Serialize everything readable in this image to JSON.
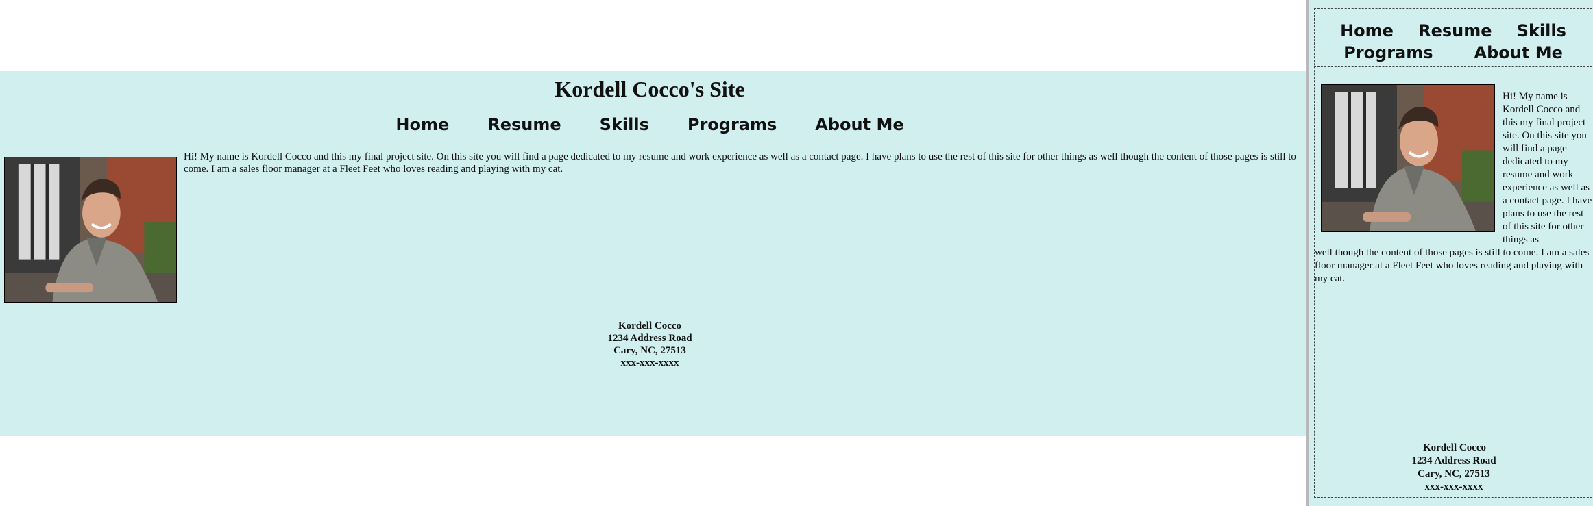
{
  "site": {
    "title": "Kordell Cocco's Site"
  },
  "nav": {
    "items": [
      {
        "label": "Home"
      },
      {
        "label": "Resume"
      },
      {
        "label": "Skills"
      },
      {
        "label": "Programs"
      },
      {
        "label": "About Me"
      }
    ]
  },
  "intro": {
    "text": "Hi! My name is Kordell Cocco and this my final project site. On this site you will find a page dedicated to my resume and work experience as well as a contact page. I have plans to use the rest of this site for other things as well though the content of those pages is still to come. I am a sales floor manager at a Fleet Feet who loves reading and playing with my cat.",
    "text_narrow_top": "Hi! My name is Kordell Cocco and this my final project site. On this site you will find a page dedicated to my resume and work experience as well as a contact page. I have plans to use the rest of this site for other things as",
    "text_narrow_bottom": "well though the content of those pages is still to come. I am a sales floor manager at a Fleet Feet who loves reading and playing with my cat."
  },
  "footer": {
    "name": "Kordell Cocco",
    "street": "1234 Address Road",
    "city": "Cary, NC, 27513",
    "phone": "xxx-xxx-xxxx"
  },
  "colors": {
    "background_band": "#d1efef",
    "page": "#ffffff",
    "text": "#111111"
  },
  "images": {
    "profile_photo": "photo of a smiling man in a grey hoodie"
  }
}
